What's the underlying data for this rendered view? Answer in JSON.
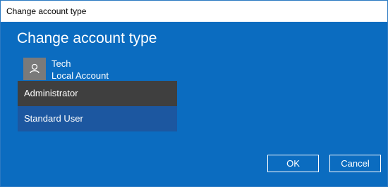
{
  "window": {
    "title": "Change account type"
  },
  "dialog": {
    "heading": "Change account type"
  },
  "user": {
    "name": "Tech",
    "account_type": "Local Account",
    "avatar_icon": "user-icon"
  },
  "dropdown": {
    "options": [
      {
        "label": "Administrator",
        "selected": true
      },
      {
        "label": "Standard User",
        "selected": false
      }
    ]
  },
  "buttons": {
    "ok_label": "OK",
    "cancel_label": "Cancel"
  },
  "colors": {
    "background": "#0b6cc0",
    "selected_option": "#3f3f3f",
    "option": "#1c57a0",
    "avatar": "#7a7a7a"
  }
}
